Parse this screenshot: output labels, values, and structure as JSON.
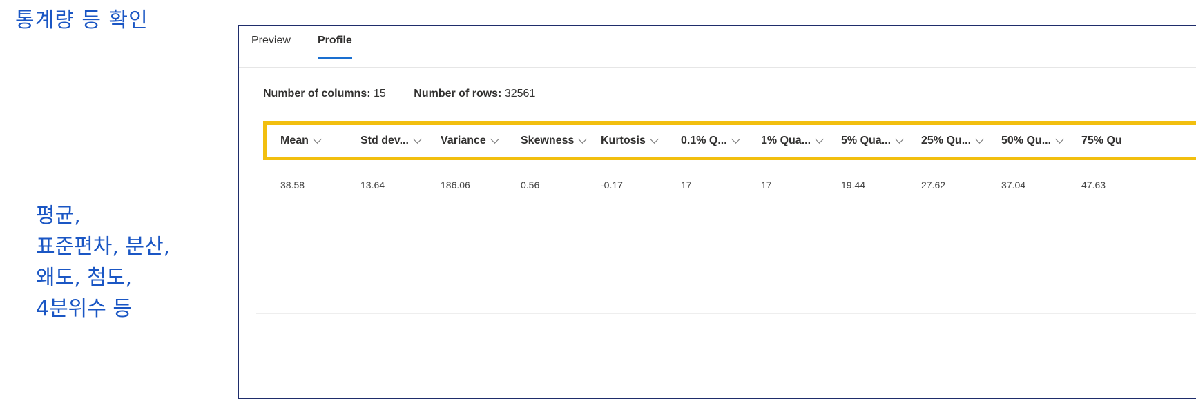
{
  "annotations": {
    "title": "통계량 등 확인",
    "note_lines": [
      "평균,",
      "표준편차, 분산,",
      "왜도, 첨도,",
      "4분위수 등"
    ]
  },
  "tabs": [
    {
      "label": "Preview",
      "active": false
    },
    {
      "label": "Profile",
      "active": true
    }
  ],
  "summary": {
    "columns_label": "Number of columns:",
    "columns_value": "15",
    "rows_label": "Number of rows:",
    "rows_value": "32561"
  },
  "table": {
    "headers": [
      "Mean",
      "Std dev...",
      "Variance",
      "Skewness",
      "Kurtosis",
      "0.1% Q...",
      "1% Qua...",
      "5% Qua...",
      "25% Qu...",
      "50% Qu...",
      "75% Qu"
    ],
    "values": [
      "38.58",
      "13.64",
      "186.06",
      "0.56",
      "-0.17",
      "17",
      "17",
      "19.44",
      "27.62",
      "37.04",
      "47.63"
    ]
  },
  "colors": {
    "annotation": "#1a56c4",
    "highlight": "#f2bf0f",
    "active_tab_underline": "#1a6fd0",
    "panel_border": "#1f2d6b"
  }
}
